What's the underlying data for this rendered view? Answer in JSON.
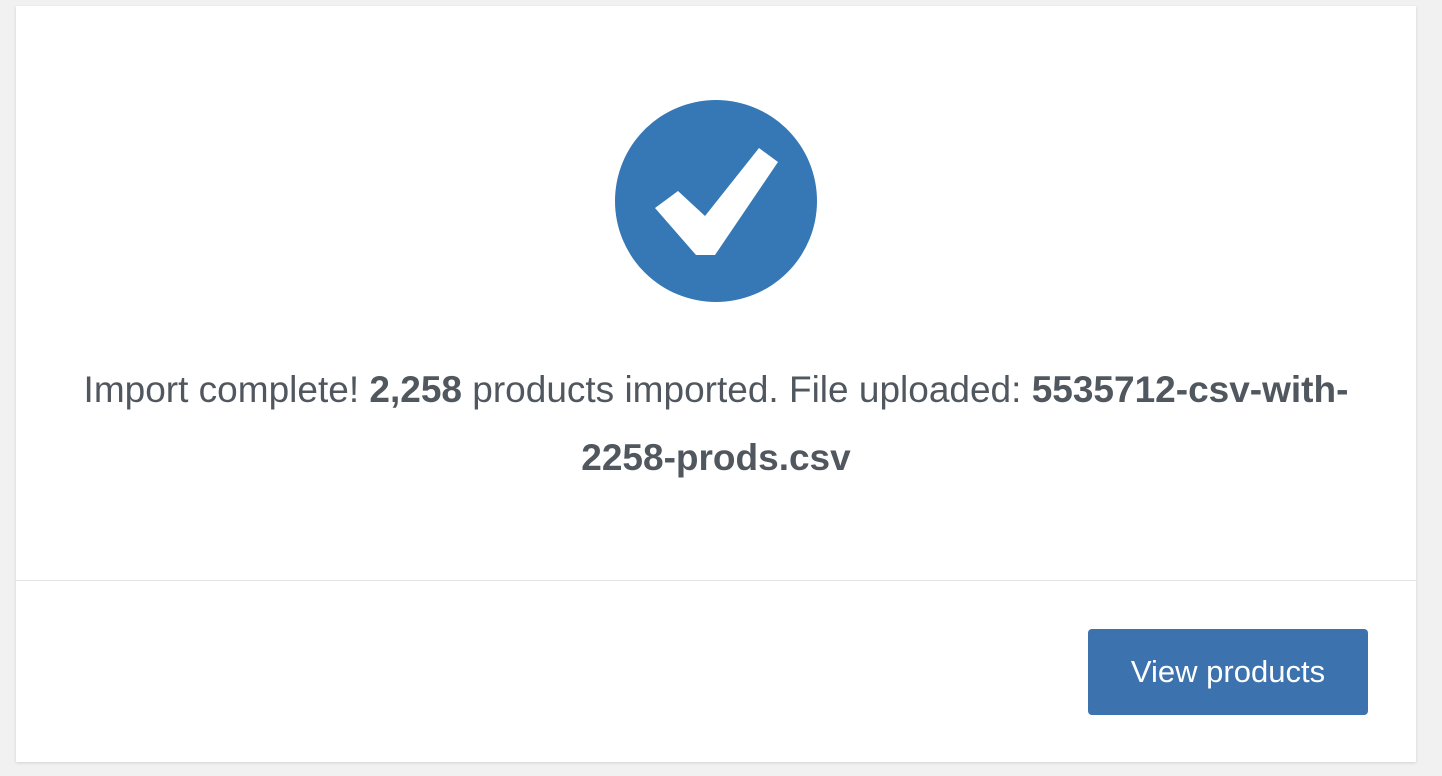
{
  "colors": {
    "accent": "#3578b5",
    "button": "#3c72ad",
    "text": "#50575e",
    "background": "#f1f1f1",
    "card": "#ffffff",
    "divider": "#e2e4e7"
  },
  "status": {
    "icon": "check-circle-icon",
    "message": {
      "prefix": "Import complete!",
      "count": "2,258",
      "middle": "products imported. File uploaded:",
      "filename": "5535712-csv-with-2258-prods.csv"
    }
  },
  "footer": {
    "view_products_label": "View products"
  }
}
